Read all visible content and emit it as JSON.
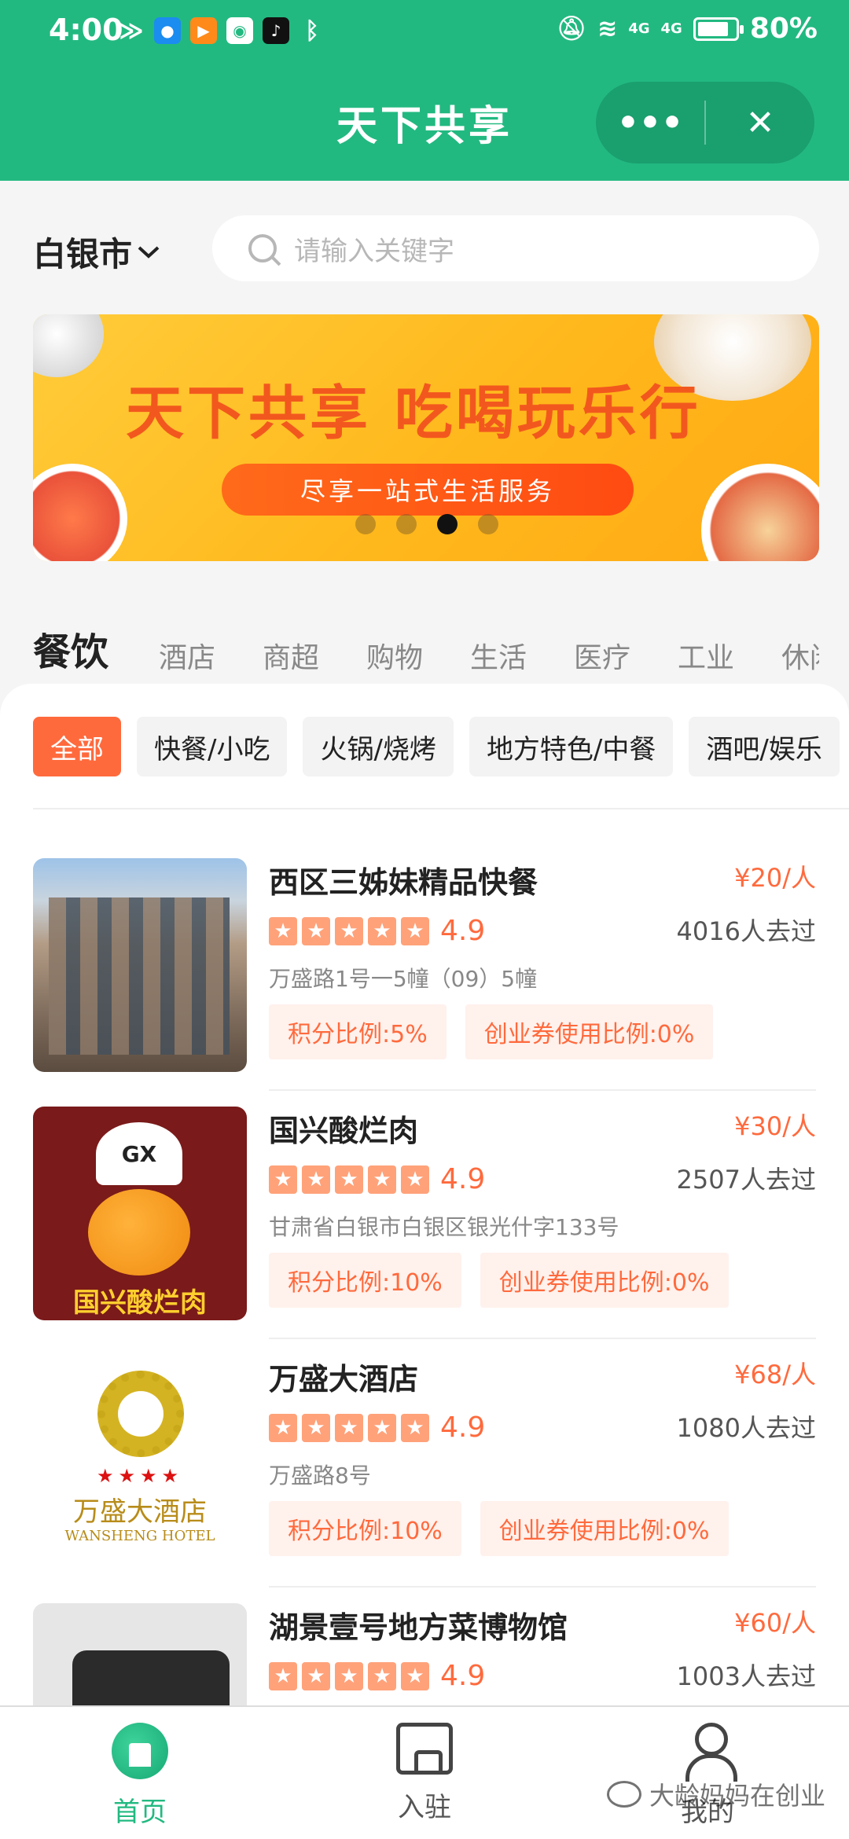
{
  "status": {
    "time": "4:00",
    "battery": "80%",
    "network_1": "4G",
    "network_2": "4G"
  },
  "header": {
    "title": "天下共享",
    "more_label": "•••",
    "close_label": "✕"
  },
  "search": {
    "city": "白银市",
    "placeholder": "请输入关键字"
  },
  "banner": {
    "title": "天下共享  吃喝玩乐行",
    "subtitle": "尽享一站式生活服务",
    "active_dot": 3,
    "dot_count": 4
  },
  "category_tabs": [
    {
      "label": "餐饮",
      "active": true
    },
    {
      "label": "酒店"
    },
    {
      "label": "商超"
    },
    {
      "label": "购物"
    },
    {
      "label": "生活"
    },
    {
      "label": "医疗"
    },
    {
      "label": "工业"
    },
    {
      "label": "休闲"
    }
  ],
  "sub_tabs": [
    {
      "label": "全部",
      "active": true
    },
    {
      "label": "快餐/小吃"
    },
    {
      "label": "火锅/烧烤"
    },
    {
      "label": "地方特色/中餐"
    },
    {
      "label": "酒吧/娱乐"
    }
  ],
  "stores": [
    {
      "name": "西区三姊妹精品快餐",
      "price": "¥20/人",
      "rating": "4.9",
      "visits": "4016人去过",
      "address": "万盛路1号一5幢（09）5幢",
      "tag1": "积分比例:5%",
      "tag2": "创业券使用比例:0%"
    },
    {
      "name": "国兴酸烂肉",
      "price": "¥30/人",
      "rating": "4.9",
      "visits": "2507人去过",
      "address": "甘肃省白银市白银区银光什字133号",
      "tag1": "积分比例:10%",
      "tag2": "创业券使用比例:0%",
      "logo_text": "国兴酸烂肉",
      "logo_badge": "GX"
    },
    {
      "name": "万盛大酒店",
      "price": "¥68/人",
      "rating": "4.9",
      "visits": "1080人去过",
      "address": "万盛路8号",
      "tag1": "积分比例:10%",
      "tag2": "创业券使用比例:0%",
      "logo_text": "万盛大酒店",
      "logo_sub": "WANSHENG HOTEL"
    },
    {
      "name": "湖景壹号地方菜博物馆",
      "price": "¥60/人",
      "rating": "4.9",
      "visits": "1003人去过"
    }
  ],
  "bottom_nav": [
    {
      "label": "首页",
      "active": true
    },
    {
      "label": "入驻"
    },
    {
      "label": "我的"
    }
  ],
  "watermark": "大龄妈妈在创业",
  "colors": {
    "brand_green": "#22b981",
    "accent_orange": "#ff6a3d"
  }
}
